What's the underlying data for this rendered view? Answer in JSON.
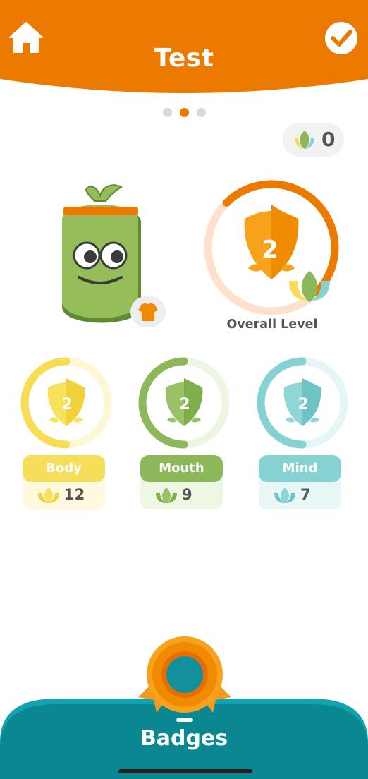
{
  "header": {
    "title": "Test",
    "home_icon": "home-icon",
    "check_icon": "check-circle-icon",
    "color": "#ec7a00"
  },
  "pager": {
    "count": 3,
    "active_index": 1
  },
  "coins": {
    "count": "0",
    "icon": "lotus-icon"
  },
  "character": {
    "outfit_icon": "shirt-icon"
  },
  "overall": {
    "level": "2",
    "label": "Overall Level",
    "progress": 0.5,
    "color": "#ec7a00"
  },
  "categories": [
    {
      "name": "Body",
      "level": "2",
      "count": "12",
      "progress": 0.5,
      "color": "#f8dc54"
    },
    {
      "name": "Mouth",
      "level": "2",
      "count": "9",
      "progress": 0.5,
      "color": "#8db85a"
    },
    {
      "name": "Mind",
      "level": "2",
      "count": "7",
      "progress": 0.5,
      "color": "#86d2d2"
    }
  ],
  "bottom_nav": {
    "label": "Badges",
    "icon": "medal-icon",
    "color": "#0a8791"
  }
}
